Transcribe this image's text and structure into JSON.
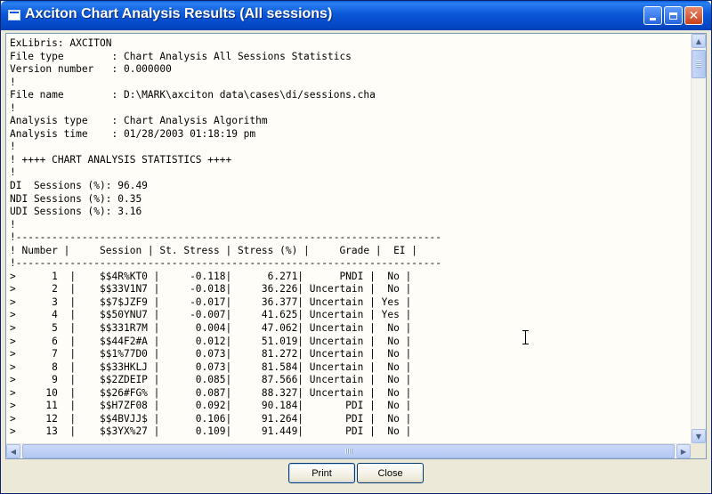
{
  "window": {
    "title": "Axciton Chart Analysis Results (All sessions)"
  },
  "report": {
    "header_lines": [
      "ExLibris: AXCITON",
      "File type        : Chart Analysis All Sessions Statistics",
      "Version number   : 0.000000",
      "!",
      "File name        : D:\\MARK\\axciton data\\cases\\di/sessions.cha",
      "!",
      "Analysis type    : Chart Analysis Algorithm",
      "Analysis time    : 01/28/2003 01:18:19 pm",
      "!",
      "! ++++ CHART ANALYSIS STATISTICS ++++",
      "!",
      "DI  Sessions (%): 96.49",
      "NDI Sessions (%): 0.35",
      "UDI Sessions (%): 3.16",
      "!",
      "!-----------------------------------------------------------------------",
      "! Number |     Session | St. Stress | Stress (%) |     Grade |  EI |",
      "!-----------------------------------------------------------------------"
    ],
    "columns": [
      "Number",
      "Session",
      "St. Stress",
      "Stress (%)",
      "Grade",
      "EI"
    ],
    "rows": [
      {
        "number": "1",
        "session": "$$4R%KT0",
        "st_stress": "-0.118",
        "stress_pct": "6.271",
        "grade": "PNDI",
        "ei": "No"
      },
      {
        "number": "2",
        "session": "$$33V1N7",
        "st_stress": "-0.018",
        "stress_pct": "36.226",
        "grade": "Uncertain",
        "ei": "No"
      },
      {
        "number": "3",
        "session": "$$7$JZF9",
        "st_stress": "-0.017",
        "stress_pct": "36.377",
        "grade": "Uncertain",
        "ei": "Yes"
      },
      {
        "number": "4",
        "session": "$$50YNU7",
        "st_stress": "-0.007",
        "stress_pct": "41.625",
        "grade": "Uncertain",
        "ei": "Yes"
      },
      {
        "number": "5",
        "session": "$$331R7M",
        "st_stress": "0.004",
        "stress_pct": "47.062",
        "grade": "Uncertain",
        "ei": "No"
      },
      {
        "number": "6",
        "session": "$$44F2#A",
        "st_stress": "0.012",
        "stress_pct": "51.019",
        "grade": "Uncertain",
        "ei": "No"
      },
      {
        "number": "7",
        "session": "$$1%77D0",
        "st_stress": "0.073",
        "stress_pct": "81.272",
        "grade": "Uncertain",
        "ei": "No"
      },
      {
        "number": "8",
        "session": "$$33HKLJ",
        "st_stress": "0.073",
        "stress_pct": "81.584",
        "grade": "Uncertain",
        "ei": "No"
      },
      {
        "number": "9",
        "session": "$$2ZDEIP",
        "st_stress": "0.085",
        "stress_pct": "87.566",
        "grade": "Uncertain",
        "ei": "No"
      },
      {
        "number": "10",
        "session": "$$26#FG%",
        "st_stress": "0.087",
        "stress_pct": "88.327",
        "grade": "Uncertain",
        "ei": "No"
      },
      {
        "number": "11",
        "session": "$$H7ZF08",
        "st_stress": "0.092",
        "stress_pct": "90.184",
        "grade": "PDI",
        "ei": "No"
      },
      {
        "number": "12",
        "session": "$$4BVJJ$",
        "st_stress": "0.106",
        "stress_pct": "91.264",
        "grade": "PDI",
        "ei": "No"
      },
      {
        "number": "13",
        "session": "$$3YX%27",
        "st_stress": "0.109",
        "stress_pct": "91.449",
        "grade": "PDI",
        "ei": "No"
      }
    ]
  },
  "buttons": {
    "print": "Print",
    "close": "Close"
  },
  "colors": {
    "titlebar": "#0a58d8",
    "window_bg": "#ece9d8",
    "text_bg": "#fffdf8"
  }
}
